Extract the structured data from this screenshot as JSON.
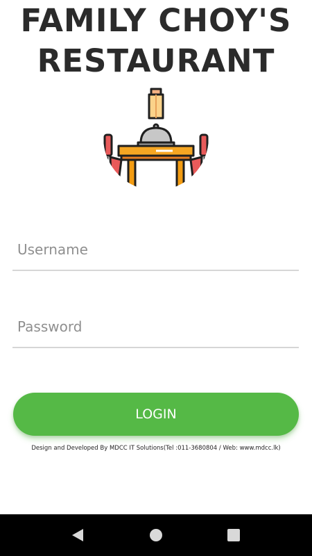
{
  "app": {
    "title_line1": "FAMILY CHOY'S",
    "title_line2": "RESTAURANT"
  },
  "logo": {
    "icon": "restaurant-table-icon"
  },
  "form": {
    "username_placeholder": "Username",
    "username_value": "",
    "password_placeholder": "Password",
    "password_value": "",
    "login_label": "LOGIN"
  },
  "footer": {
    "credits": "Design and Developed By MDCC IT Solutions(Tel :011-3680804 / Web: www.mdcc.lk)"
  },
  "system_nav": {
    "back_icon": "back-triangle-icon",
    "home_icon": "home-circle-icon",
    "recents_icon": "recents-square-icon"
  },
  "colors": {
    "title": "#2b2b2b",
    "accent": "#55b946",
    "underline": "#d6d6d6",
    "navbar": "#000000"
  }
}
